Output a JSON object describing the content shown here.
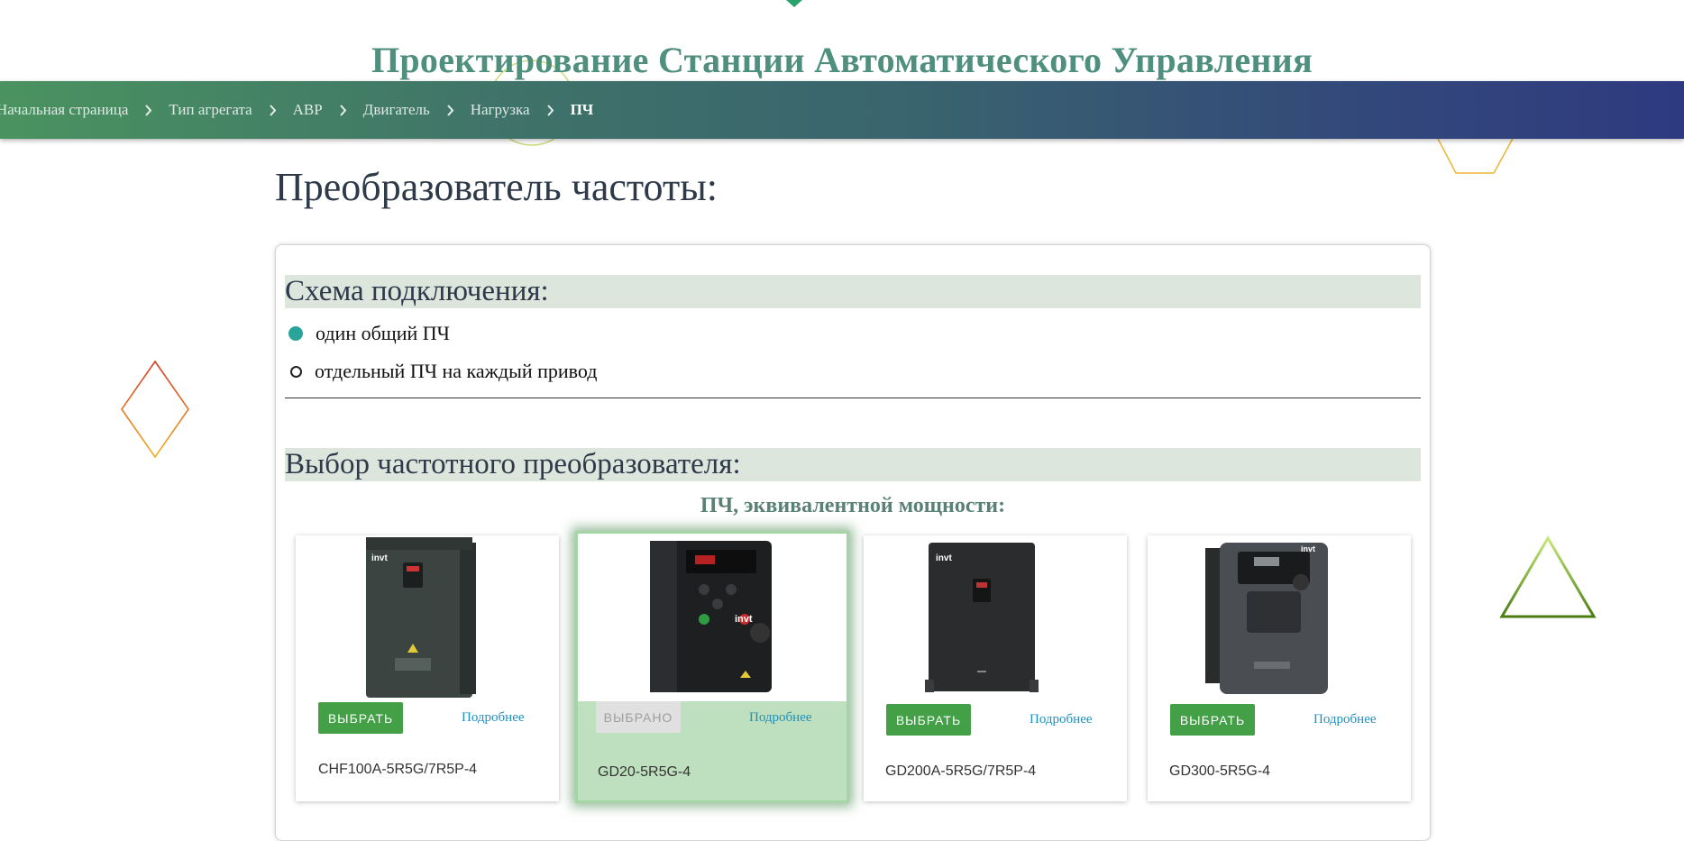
{
  "site": {
    "title": "Проектирование Станции Автоматического Управления"
  },
  "breadcrumb": [
    {
      "label": "Начальная страница"
    },
    {
      "label": "Тип агрегата"
    },
    {
      "label": "АВР"
    },
    {
      "label": "Двигатель"
    },
    {
      "label": "Нагрузка"
    },
    {
      "label": "ПЧ"
    }
  ],
  "page": {
    "title": "Преобразователь частоты:"
  },
  "scheme": {
    "heading": "Схема подключения:",
    "options": [
      {
        "label": "один общий ПЧ",
        "checked": true
      },
      {
        "label": "отдельный ПЧ на каждый привод",
        "checked": false
      }
    ]
  },
  "selection": {
    "heading": "Выбор частотного преобразователя:",
    "subheading": "ПЧ, эквивалентной мощности:",
    "cards": [
      {
        "model": "CHF100A-5R5G/7R5P-4",
        "button": "ВЫБРАТЬ",
        "more": "Подробнее",
        "selected": false,
        "brand": "invt"
      },
      {
        "model": "GD20-5R5G-4",
        "button": "ВЫБРАНО",
        "more": "Подробнее",
        "selected": true,
        "brand": "invt"
      },
      {
        "model": "GD200A-5R5G/7R5P-4",
        "button": "ВЫБРАТЬ",
        "more": "Подробнее",
        "selected": false,
        "brand": "invt"
      },
      {
        "model": "GD300-5R5G-4",
        "button": "ВЫБРАТЬ",
        "more": "Подробнее",
        "selected": false,
        "brand": "invt"
      }
    ]
  },
  "colors": {
    "accent_green": "#43a047",
    "title_teal": "#4f8f7d",
    "radio_checked": "#2aa39a",
    "link_blue": "#1f8fbf",
    "header_gradient_start": "#4a9360",
    "header_gradient_end": "#2e3a80"
  }
}
